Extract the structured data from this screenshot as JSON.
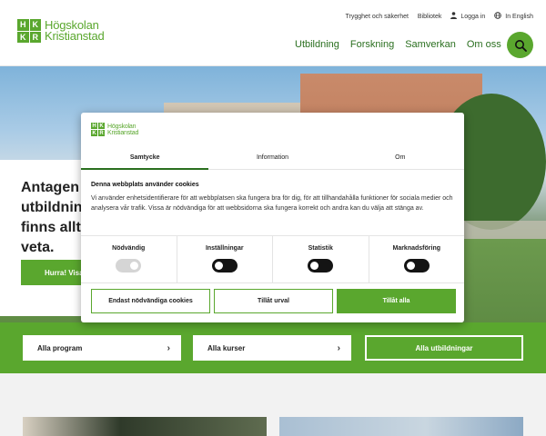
{
  "header": {
    "logo_line1": "Högskolan",
    "logo_line2": "Kristianstad",
    "logo_letters": [
      "H",
      "K",
      "K",
      "R"
    ],
    "utility": {
      "safety": "Trygghet och säkerhet",
      "library": "Bibliotek",
      "login": "Logga in",
      "english": "In English"
    },
    "nav": [
      "Utbildning",
      "Forskning",
      "Samverkan",
      "Om oss"
    ]
  },
  "hero": {
    "title": "Antagen\nutbildning\nfinns allt\nveta.",
    "button": "Hurra! Visa"
  },
  "band": {
    "all_programs": "Alla program",
    "all_courses": "Alla kurser",
    "all_educations": "Alla utbildningar"
  },
  "cookie": {
    "logo_line1": "Högskolan",
    "logo_line2": "Kristianstad",
    "tabs": [
      "Samtycke",
      "Information",
      "Om"
    ],
    "heading": "Denna webbplats använder cookies",
    "body": "Vi använder enhetsidentifierare för att webbplatsen ska fungera bra för dig, för att tillhandahålla funktioner för sociala medier och analysera vår trafik. Vissa är nödvändiga för att webbsidorna ska fungera korrekt och andra kan du välja att stänga av.",
    "toggles": [
      {
        "label": "Nödvändig",
        "state": "on-disabled"
      },
      {
        "label": "Inställningar",
        "state": "off"
      },
      {
        "label": "Statistik",
        "state": "off"
      },
      {
        "label": "Marknadsföring",
        "state": "off"
      }
    ],
    "buttons": {
      "necessary_only": "Endast nödvändiga cookies",
      "allow_selection": "Tillåt urval",
      "allow_all": "Tillåt alla"
    }
  },
  "colors": {
    "brand_green": "#5aa72e",
    "nav_text": "#2a6f1f"
  }
}
